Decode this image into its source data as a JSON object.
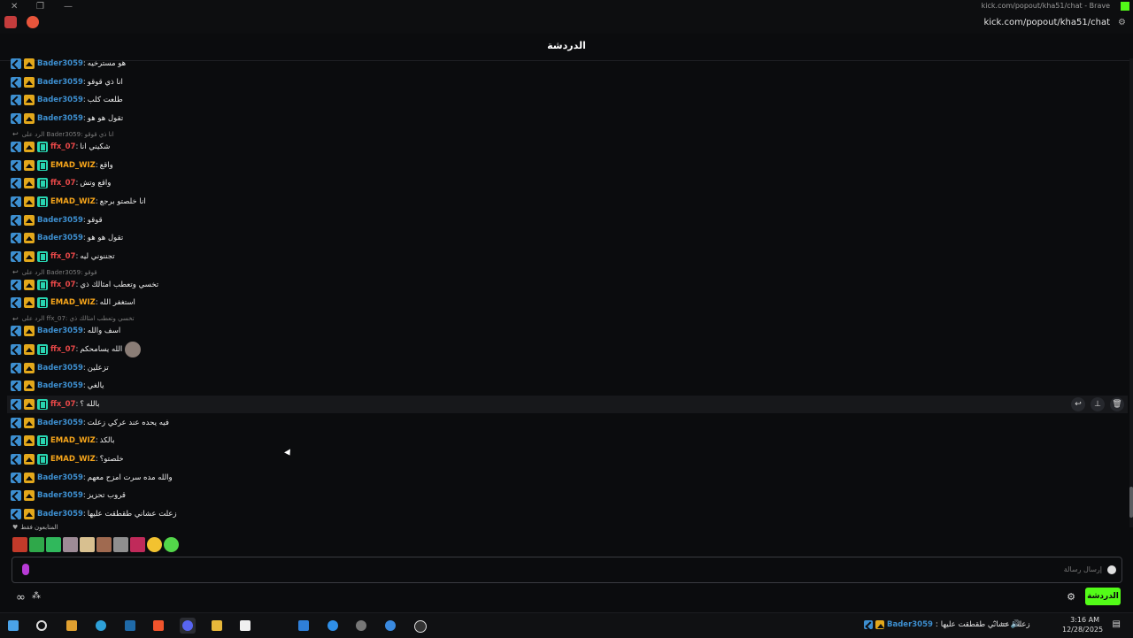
{
  "browser": {
    "window_title": "kick.com/popout/kha51/chat - Brave",
    "url": "kick.com/popout/kha51/chat"
  },
  "header": {
    "title": "الدردشة"
  },
  "colors": {
    "blue_user": "#3d8fd0",
    "orange_user": "#f6a51b",
    "red_user": "#e84848",
    "kick_green": "#53fc18",
    "crown": "#e3a81b",
    "og_badge": "#28d4b0"
  },
  "messages": [
    {
      "kind": "msg",
      "user": "Bader3059",
      "color": "#3d8fd0",
      "text": "هو مسترخيه",
      "og": false
    },
    {
      "kind": "msg",
      "user": "Bader3059",
      "color": "#3d8fd0",
      "text": "انا ذي قوقو",
      "og": false
    },
    {
      "kind": "msg",
      "user": "Bader3059",
      "color": "#3d8fd0",
      "text": "طلعت كلب",
      "og": false
    },
    {
      "kind": "msg",
      "user": "Bader3059",
      "color": "#3d8fd0",
      "text": "تقول هو هو",
      "og": false
    },
    {
      "kind": "reply",
      "text": "الرد على Bader3059: انا ذي قوقو"
    },
    {
      "kind": "msg",
      "user": "ffx_07",
      "color": "#e84848",
      "text": "شكيني انا",
      "og": true
    },
    {
      "kind": "msg",
      "user": "EMAD_WIZ",
      "color": "#f6a51b",
      "text": "واقع",
      "og": true
    },
    {
      "kind": "msg",
      "user": "ffx_07",
      "color": "#e84848",
      "text": "واقع وتش",
      "og": true
    },
    {
      "kind": "msg",
      "user": "EMAD_WIZ",
      "color": "#f6a51b",
      "text": "انا خلصتو برجع",
      "og": true
    },
    {
      "kind": "msg",
      "user": "Bader3059",
      "color": "#3d8fd0",
      "text": "قوقو",
      "og": false
    },
    {
      "kind": "msg",
      "user": "Bader3059",
      "color": "#3d8fd0",
      "text": "تقول هو هو",
      "og": false
    },
    {
      "kind": "msg",
      "user": "ffx_07",
      "color": "#e84848",
      "text": "تجننوني ليه",
      "og": true
    },
    {
      "kind": "reply",
      "text": "الرد على Bader3059: قوقو"
    },
    {
      "kind": "msg",
      "user": "ffx_07",
      "color": "#e84848",
      "text": "تخسي وتعطب امثالك ذي",
      "og": true
    },
    {
      "kind": "msg",
      "user": "EMAD_WIZ",
      "color": "#f6a51b",
      "text": "استغفر الله",
      "og": true
    },
    {
      "kind": "reply",
      "text": "الرد على ffx_07: تخسي وتعطب امثالك ذي"
    },
    {
      "kind": "msg",
      "user": "Bader3059",
      "color": "#3d8fd0",
      "text": "اسف والله",
      "og": false
    },
    {
      "kind": "msg",
      "user": "ffx_07",
      "color": "#e84848",
      "text": "الله يسامحكم",
      "og": true,
      "emoji": true
    },
    {
      "kind": "msg",
      "user": "Bader3059",
      "color": "#3d8fd0",
      "text": "تزعلين",
      "og": false
    },
    {
      "kind": "msg",
      "user": "Bader3059",
      "color": "#3d8fd0",
      "text": "يالغي",
      "og": false
    },
    {
      "kind": "msg",
      "user": "ffx_07",
      "color": "#e84848",
      "text": "بالله ؟",
      "og": true,
      "highlight": true
    },
    {
      "kind": "msg",
      "user": "Bader3059",
      "color": "#3d8fd0",
      "text": "فيه يحده عند عركي زعلت",
      "og": false
    },
    {
      "kind": "msg",
      "user": "EMAD_WIZ",
      "color": "#f6a51b",
      "text": "بالكذ",
      "og": true
    },
    {
      "kind": "msg",
      "user": "EMAD_WIZ",
      "color": "#f6a51b",
      "text": "خلصتو؟",
      "og": true
    },
    {
      "kind": "msg",
      "user": "Bader3059",
      "color": "#3d8fd0",
      "text": "والله مده سرت امزح معهم",
      "og": false
    },
    {
      "kind": "msg",
      "user": "Bader3059",
      "color": "#3d8fd0",
      "text": "قروب تحزيز",
      "og": false
    },
    {
      "kind": "msg",
      "user": "Bader3059",
      "color": "#3d8fd0",
      "text": "زعلت عشاني طقطقت عليها",
      "og": false
    }
  ],
  "viewers": {
    "label": "المتابعون فقط",
    "avatars": [
      "#c23a2a",
      "#2fa84a",
      "#30b85c",
      "#9e8b96",
      "#d8c090",
      "#a06a50",
      "#8f8f8f",
      "#c02a5a",
      "#f2c230",
      "#53d64a"
    ]
  },
  "input": {
    "placeholder": "إرسال رسالة"
  },
  "bottom": {
    "chat_button": "الدردشة"
  },
  "taskbar": {
    "notification_user": "Bader3059",
    "notification_text": "زعلت عشاني طقطقت عليها",
    "time": "3:16 AM",
    "date": "12/28/2025"
  }
}
